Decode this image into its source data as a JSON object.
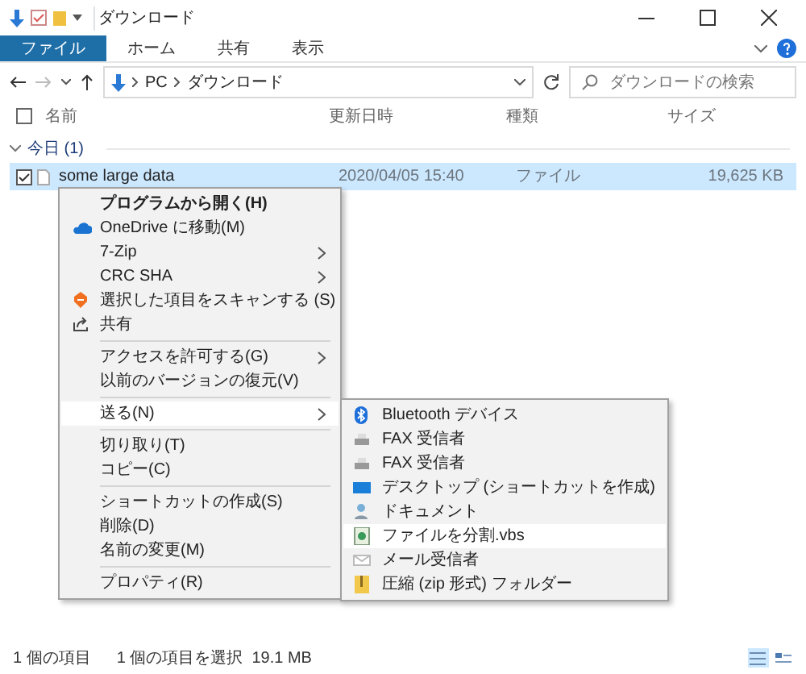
{
  "window": {
    "title": "ダウンロード"
  },
  "ribbon_tabs": [
    {
      "label": "ファイル",
      "kind": "file",
      "selected": false
    },
    {
      "label": "ホーム",
      "kind": "tab",
      "selected": false
    },
    {
      "label": "共有",
      "kind": "tab",
      "selected": false
    },
    {
      "label": "表示",
      "kind": "tab",
      "selected": false
    }
  ],
  "header_checkbox": {
    "checked": false
  },
  "address": {
    "path": [
      "PC",
      "ダウンロード"
    ],
    "search_placeholder": "ダウンロードの検索"
  },
  "columns": [
    "名前",
    "更新日時",
    "種類",
    "サイズ"
  ],
  "groups": [
    {
      "label": "今日 (1)",
      "expanded": true,
      "files": [
        {
          "name": "some large data",
          "modified": "2020/04/05 15:40",
          "type": "ファイル",
          "size": "19,625 KB",
          "checked": true,
          "selected": true
        }
      ]
    }
  ],
  "context_menu": {
    "groups": [
      [
        {
          "label": "プログラムから開く(H)",
          "default": true,
          "submenu": false,
          "selected": false
        },
        {
          "label": "OneDrive に移動(M)",
          "default": false,
          "submenu": false,
          "selected": false
        },
        {
          "label": "7-Zip",
          "default": false,
          "submenu": true,
          "selected": false
        },
        {
          "label": "CRC SHA",
          "default": false,
          "submenu": true,
          "selected": false
        },
        {
          "label": "選択した項目をスキャンする (S)",
          "default": false,
          "submenu": false,
          "selected": false
        },
        {
          "label": "共有",
          "default": false,
          "submenu": false,
          "selected": false
        }
      ],
      [
        {
          "label": "アクセスを許可する(G)",
          "default": false,
          "submenu": true,
          "selected": false
        },
        {
          "label": "以前のバージョンの復元(V)",
          "default": false,
          "submenu": false,
          "selected": false
        }
      ],
      [
        {
          "label": "送る(N)",
          "default": false,
          "submenu": true,
          "selected": true
        }
      ],
      [
        {
          "label": "切り取り(T)",
          "default": false,
          "submenu": false,
          "selected": false
        },
        {
          "label": "コピー(C)",
          "default": false,
          "submenu": false,
          "selected": false
        }
      ],
      [
        {
          "label": "ショートカットの作成(S)",
          "default": false,
          "submenu": false,
          "selected": false
        },
        {
          "label": "削除(D)",
          "default": false,
          "submenu": false,
          "selected": false
        },
        {
          "label": "名前の変更(M)",
          "default": false,
          "submenu": false,
          "selected": false
        }
      ],
      [
        {
          "label": "プロパティ(R)",
          "default": false,
          "submenu": false,
          "selected": false
        }
      ]
    ]
  },
  "send_to_menu": [
    {
      "label": "Bluetooth デバイス",
      "selected": false
    },
    {
      "label": "FAX 受信者",
      "selected": false
    },
    {
      "label": "FAX 受信者",
      "selected": false
    },
    {
      "label": "デスクトップ (ショートカットを作成)",
      "selected": false
    },
    {
      "label": "ドキュメント",
      "selected": false
    },
    {
      "label": "ファイルを分割.vbs",
      "selected": true
    },
    {
      "label": "メール受信者",
      "selected": false
    },
    {
      "label": "圧縮 (zip 形式) フォルダー",
      "selected": false
    }
  ],
  "status_bar": {
    "item_count": "1 個の項目",
    "selection": "1 個の項目を選択  19.1 MB",
    "view_buttons": [
      {
        "kind": "details",
        "selected": true
      },
      {
        "kind": "tiles",
        "selected": false
      }
    ]
  }
}
